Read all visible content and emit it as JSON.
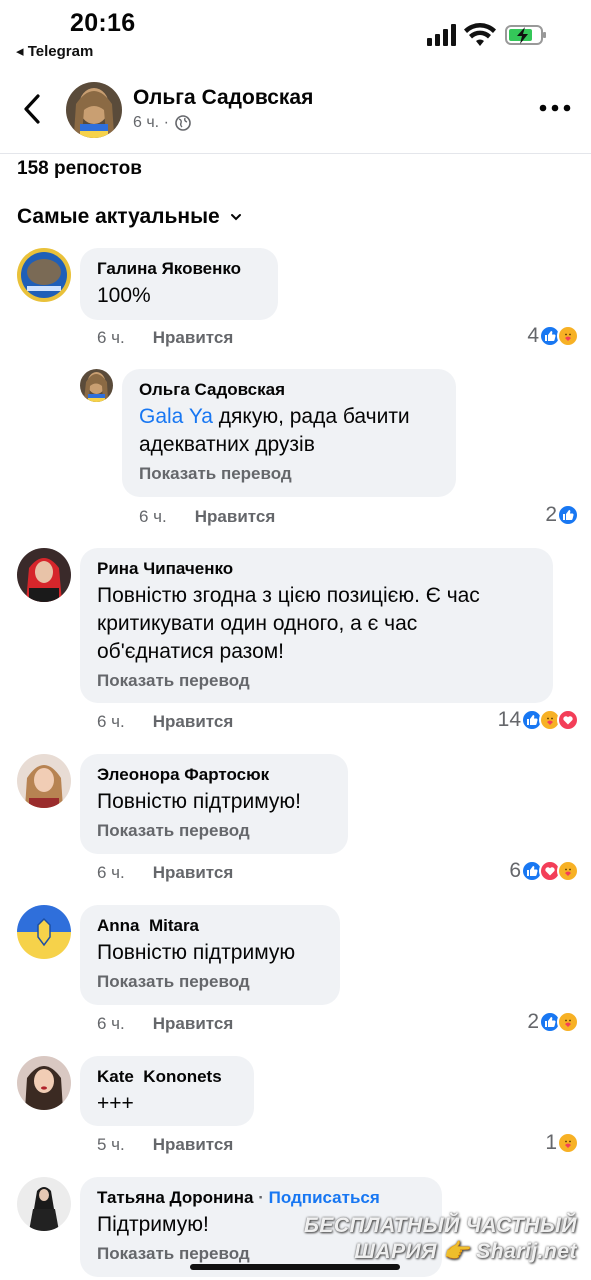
{
  "status_bar": {
    "time": "20:16",
    "back_app": "◂ Telegram"
  },
  "header": {
    "name": "Ольга Садовская",
    "meta": "6 ч. ·"
  },
  "reposts": "158 репостов",
  "sort_label": "Самые актуальные",
  "ui": {
    "like_label": "Нравится",
    "translate_label": "Показать перевод"
  },
  "comments": [
    {
      "name": "Галина Яковенко",
      "text": "100%",
      "time": "6 ч.",
      "count": "4",
      "reactions": [
        "like",
        "care"
      ]
    },
    {
      "name": "Ольга Садовская",
      "tag": "Gala Ya",
      "text": " дякую, рада бачити адекватних друзів",
      "time": "6 ч.",
      "count": "2",
      "reactions": [
        "like"
      ]
    },
    {
      "name": "Рина Чипаченко",
      "text": "Повністю згодна з цією позицією. Є час критикувати один одного, а є час об'єднатися разом!",
      "time": "6 ч.",
      "count": "14",
      "reactions": [
        "like",
        "care",
        "love"
      ]
    },
    {
      "name": "Элеонора Фартосюк",
      "text": "Повністю підтримую!",
      "time": "6 ч.",
      "count": "6",
      "reactions": [
        "like",
        "love",
        "care"
      ]
    },
    {
      "name": "Anna  Mitara",
      "text": "Повністю підтримую",
      "time": "6 ч.",
      "count": "2",
      "reactions": [
        "like",
        "care"
      ]
    },
    {
      "name": "Kate  Kononets",
      "text": "+++",
      "time": "5 ч.",
      "count": "1",
      "reactions": [
        "care"
      ]
    },
    {
      "name": "Татьяна Доронина",
      "subscribe": "Подписаться",
      "text": "Підтримую!",
      "time": "",
      "count": "",
      "reactions": []
    }
  ],
  "watermark": {
    "line1": "БЕСПЛАТНЫЙ ЧАСТНЫЙ",
    "line2": "ШАРИЯ 👉 Sharij.net"
  },
  "colors": {
    "accent": "#1877f2",
    "bubble": "#f0f2f5",
    "muted": "#65676b",
    "love": "#f33e58",
    "care": "#f7b125"
  }
}
